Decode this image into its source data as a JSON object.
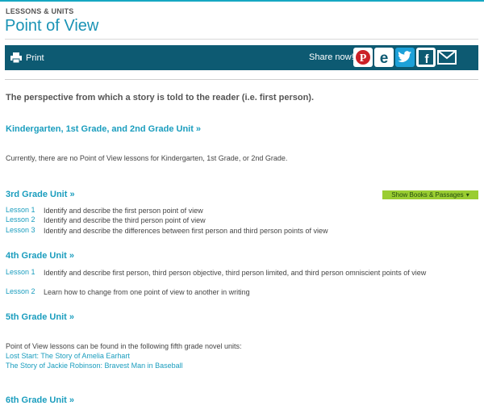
{
  "header": {
    "eyebrow": "LESSONS & UNITS",
    "title": "Point of View"
  },
  "toolbar": {
    "print_label": "Print",
    "share_label": "Share now!",
    "share": [
      "pinterest-icon",
      "edmodo-icon",
      "twitter-icon",
      "facebook-icon",
      "email-icon"
    ]
  },
  "intro": "The perspective from which a story is told to the reader (i.e. first person).",
  "sections": {
    "k2": {
      "title": "Kindergarten, 1st Grade, and 2nd Grade Unit »",
      "note": "Currently, there are no Point of View lessons for Kindergarten, 1st Grade, or 2nd Grade."
    },
    "g3": {
      "title": "3rd Grade Unit »",
      "show_books": "Show Books & Passages",
      "lessons": [
        {
          "link": "Lesson 1",
          "text": "Identify and describe the first person point of view"
        },
        {
          "link": "Lesson 2",
          "text": "Identify and describe the third person point of view"
        },
        {
          "link": "Lesson 3",
          "text": "Identify and describe the differences between first person and third person points of view"
        }
      ]
    },
    "g4": {
      "title": "4th Grade Unit »",
      "lessons": [
        {
          "link": "Lesson 1",
          "text": "Identify and describe first person, third person objective, third person limited, and third person omniscient points of view"
        },
        {
          "link": "Lesson 2",
          "text": "Learn how to change from one point of view to another in writing"
        }
      ]
    },
    "g5": {
      "title": "5th Grade Unit »",
      "note": "Point of View lessons can be found in the following fifth grade novel units:",
      "books": [
        "Lost Start: The Story of Amelia Earhart",
        "The Story of Jackie Robinson: Bravest Man in Baseball"
      ]
    },
    "g6": {
      "title": "6th Grade Unit »"
    }
  }
}
